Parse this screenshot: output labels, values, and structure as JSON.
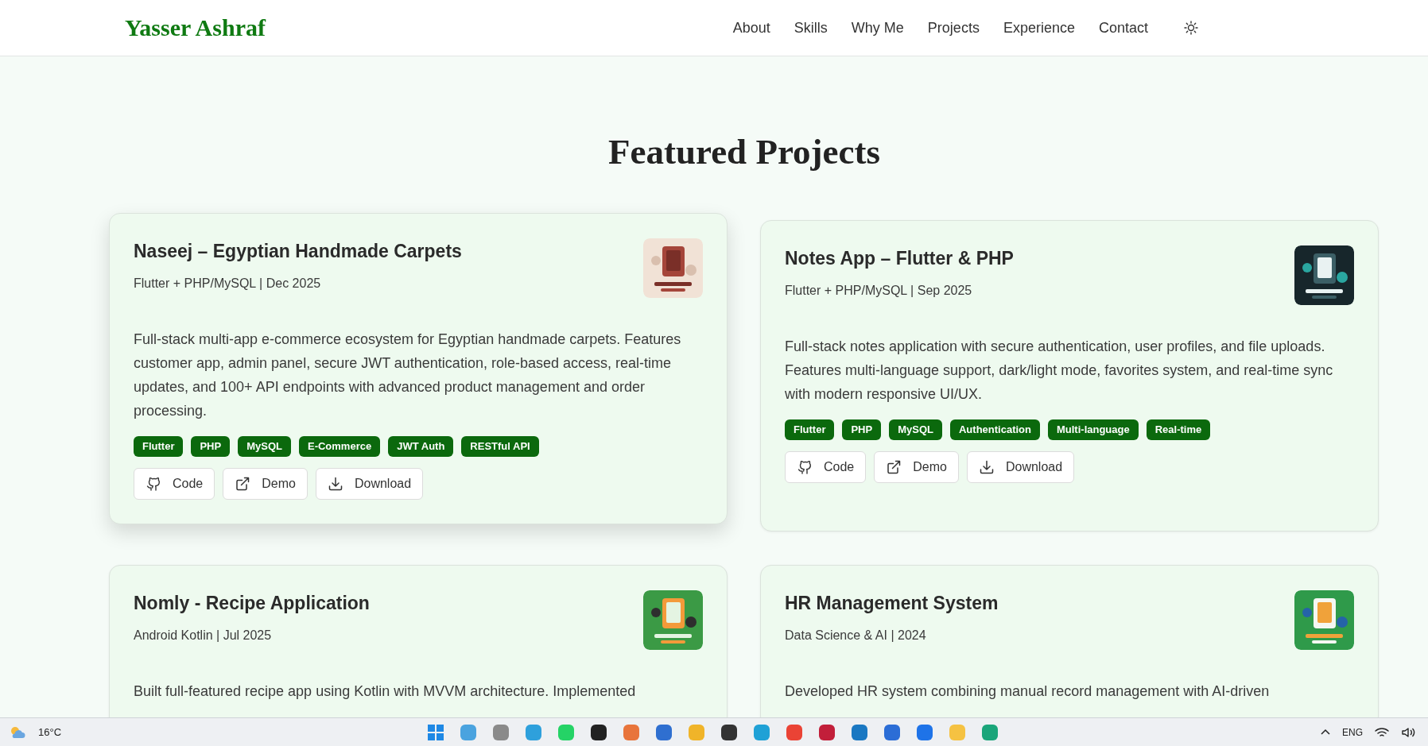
{
  "nav": {
    "logo": "Yasser Ashraf",
    "links": [
      "About",
      "Skills",
      "Why Me",
      "Projects",
      "Experience",
      "Contact"
    ]
  },
  "section": {
    "title": "Featured Projects"
  },
  "projects": [
    {
      "title": "Naseej – Egyptian Handmade Carpets",
      "meta": "Flutter + PHP/MySQL | Dec 2025",
      "raised": true,
      "thumbnail": {
        "kind": "picture"
      },
      "description": "Full-stack multi-app e-commerce ecosystem for Egyptian handmade carpets. Features customer app, admin panel, secure JWT authentication, role-based access, real-time updates, and 100+ API endpoints with advanced product management and order processing.",
      "tags": [
        "Flutter",
        "PHP",
        "MySQL",
        "E-Commerce",
        "JWT Auth",
        "RESTful API"
      ],
      "buttons": [
        {
          "kind": "code",
          "label": "Code"
        },
        {
          "kind": "demo",
          "label": "Demo"
        },
        {
          "kind": "download",
          "label": "Download"
        }
      ]
    },
    {
      "title": "Notes App – Flutter & PHP",
      "meta": "Flutter + PHP/MySQL | Sep 2025",
      "raised": false,
      "thumbnail": {
        "kind": "picture"
      },
      "description": "Full-stack notes application with secure authentication, user profiles, and file uploads. Features multi-language support, dark/light mode, favorites system, and real-time sync with modern responsive UI/UX.",
      "tags": [
        "Flutter",
        "PHP",
        "MySQL",
        "Authentication",
        "Multi-language",
        "Real-time"
      ],
      "buttons": [
        {
          "kind": "code",
          "label": "Code"
        },
        {
          "kind": "demo",
          "label": "Demo"
        },
        {
          "kind": "download",
          "label": "Download"
        }
      ]
    },
    {
      "title": "Nomly - Recipe Application",
      "meta": "Android Kotlin | Jul 2025",
      "raised": false,
      "thumbnail": {
        "kind": "picture"
      },
      "description": "Built full-featured recipe app using Kotlin with MVVM architecture. Implemented"
    },
    {
      "title": "HR Management System",
      "meta": "Data Science & AI | 2024",
      "raised": false,
      "thumbnail": {
        "kind": "picture"
      },
      "description": "Developed HR system combining manual record management with AI-driven"
    }
  ],
  "taskbar": {
    "temperature": "16°C",
    "language": "ENG"
  }
}
